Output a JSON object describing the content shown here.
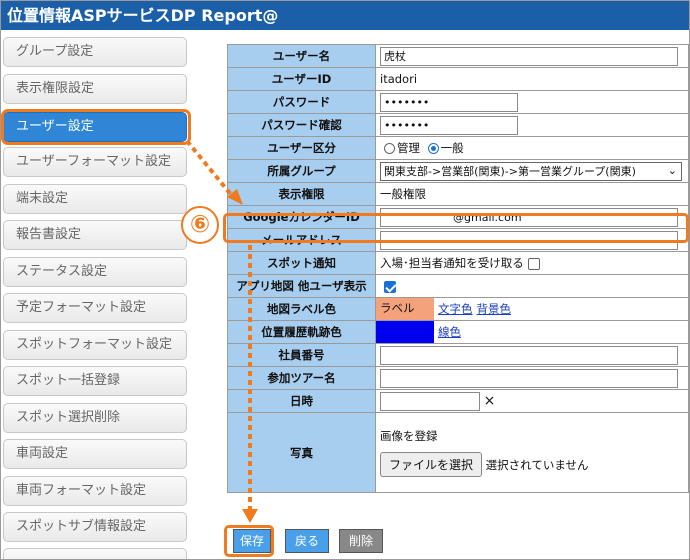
{
  "app": {
    "title": "位置情報ASPサービスDP Report@"
  },
  "sidebar": {
    "items": [
      {
        "label": "グループ設定"
      },
      {
        "label": "表示権限設定"
      },
      {
        "label": "ユーザー設定"
      },
      {
        "label": "ユーザーフォーマット設定"
      },
      {
        "label": "端末設定"
      },
      {
        "label": "報告書設定"
      },
      {
        "label": "ステータス設定"
      },
      {
        "label": "予定フォーマット設定"
      },
      {
        "label": "スポットフォーマット設定"
      },
      {
        "label": "スポット一括登録"
      },
      {
        "label": "スポット選択削除"
      },
      {
        "label": "車両設定"
      },
      {
        "label": "車両フォーマット設定"
      },
      {
        "label": "スポットサブ情報設定"
      }
    ],
    "active_index": 2
  },
  "form": {
    "username": {
      "label": "ユーザー名",
      "value": "虎杖"
    },
    "userid": {
      "label": "ユーザーID",
      "value": "itadori"
    },
    "password": {
      "label": "パスワード",
      "value": "•••••••"
    },
    "password_confirm": {
      "label": "パスワード確認",
      "value": "•••••••"
    },
    "user_type": {
      "label": "ユーザー区分",
      "option_admin": "管理",
      "option_general": "一般",
      "selected": "一般"
    },
    "group": {
      "label": "所属グループ",
      "value": "関東支部->営業部(関東)->第一営業グループ(関東)"
    },
    "permission": {
      "label": "表示権限",
      "value": "一般権限"
    },
    "google_calendar": {
      "label": "GoogleカレンダーID",
      "value": "@gmail.com"
    },
    "email": {
      "label": "メールアドレス",
      "value": ""
    },
    "spot_notify": {
      "label": "スポット通知",
      "text": "入場･担当者通知を受け取る",
      "checked": false
    },
    "app_map_other": {
      "label": "アプリ地図 他ユーザ表示",
      "checked": true
    },
    "map_label_color": {
      "label": "地図ラベル色",
      "swatch_text": "ラベル",
      "swatch_color": "#f4a27c",
      "text_color_link": "文字色",
      "bg_color_link": "背景色"
    },
    "track_color": {
      "label": "位置履歴軌跡色",
      "swatch_color": "#0000ee",
      "line_color_link": "線色"
    },
    "employee_no": {
      "label": "社員番号",
      "value": ""
    },
    "tour": {
      "label": "参加ツアー名",
      "value": ""
    },
    "datetime": {
      "label": "日時",
      "value": "",
      "clear": "×"
    },
    "photo": {
      "label": "写真",
      "register_text": "画像を登録",
      "file_button": "ファイルを選択",
      "no_file": "選択されていません"
    }
  },
  "buttons": {
    "save": "保存",
    "back": "戻る",
    "delete": "削除"
  },
  "annotation": {
    "step_number": "⑥",
    "color": "#f07a1e"
  }
}
